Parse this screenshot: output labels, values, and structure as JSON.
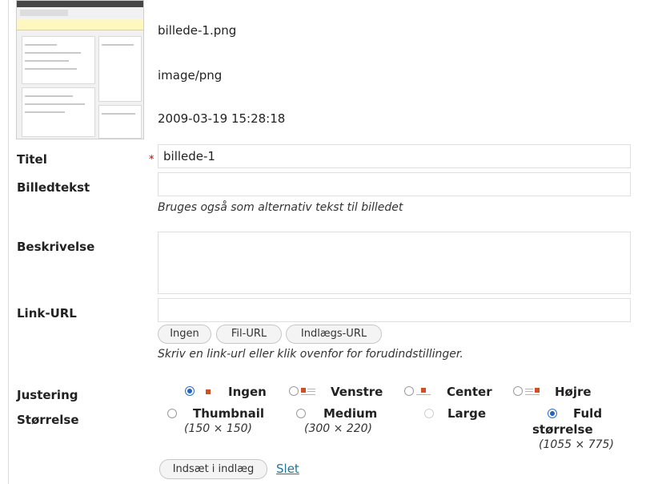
{
  "file": {
    "name": "billede-1.png",
    "type": "image/png",
    "date": "2009-03-19 15:28:18"
  },
  "title_field": {
    "label": "Titel",
    "required_mark": "*",
    "value": "billede-1"
  },
  "caption_field": {
    "label": "Billedtekst",
    "value": "",
    "help": "Bruges også som alternativ tekst til billedet"
  },
  "description_field": {
    "label": "Beskrivelse",
    "value": ""
  },
  "link_field": {
    "label": "Link-URL",
    "value": "",
    "buttons": {
      "none": "Ingen",
      "file_url": "Fil-URL",
      "post_url": "Indlægs-URL"
    },
    "help": "Skriv en link-url eller klik ovenfor for forudindstillinger."
  },
  "alignment": {
    "label": "Justering",
    "options": {
      "none": "Ingen",
      "left": "Venstre",
      "center": "Center",
      "right": "Højre"
    },
    "selected": "none",
    "accent_color": "#d54e21"
  },
  "size": {
    "label": "Størrelse",
    "options": {
      "thumbnail": {
        "label": "Thumbnail",
        "dims": "(150 × 150)"
      },
      "medium": {
        "label": "Medium",
        "dims": "(300 × 220)"
      },
      "large": {
        "label": "Large"
      },
      "full": {
        "label_1": "Fuld",
        "label_2": "størrelse",
        "dims": "(1055 × 775)"
      }
    },
    "selected": "full"
  },
  "actions": {
    "insert": "Indsæt i indlæg",
    "delete": "Slet"
  }
}
